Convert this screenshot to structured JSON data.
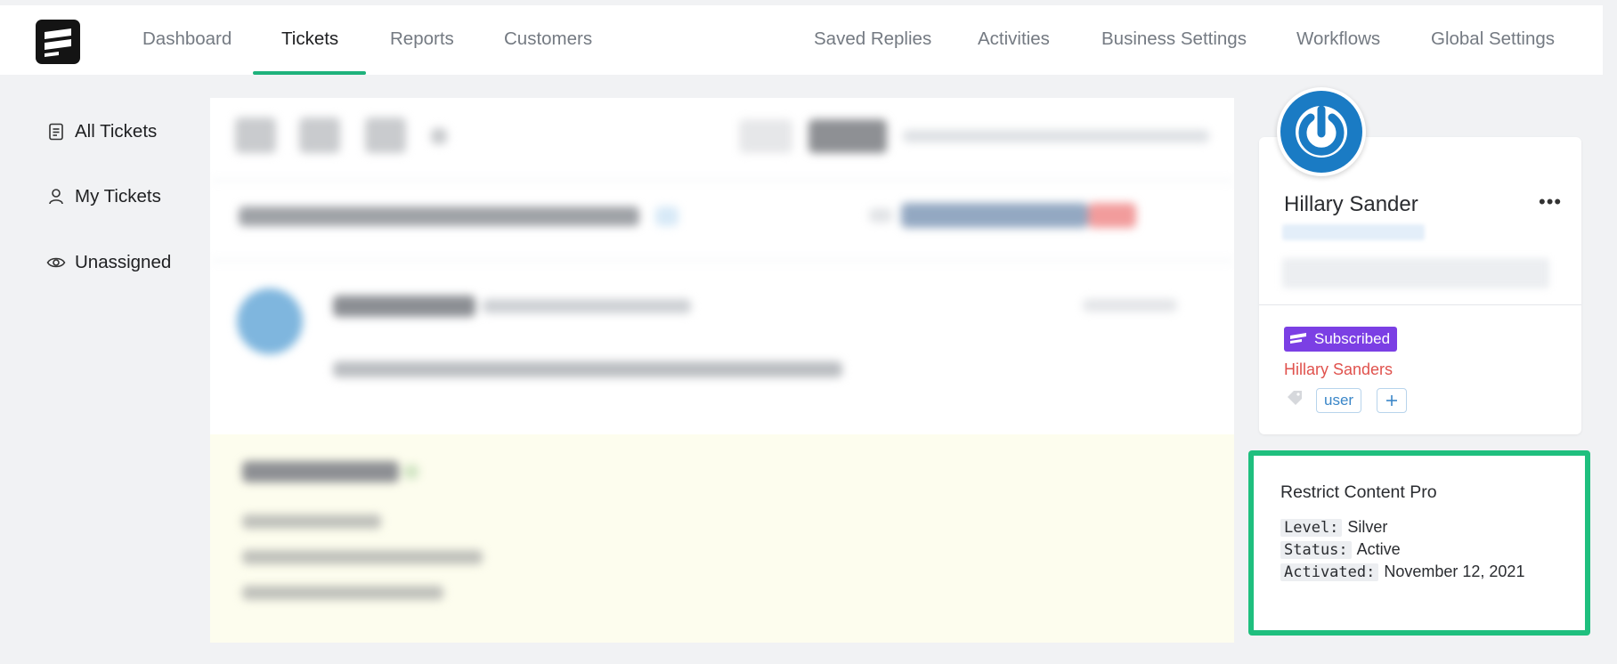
{
  "nav": {
    "left": [
      "Dashboard",
      "Tickets",
      "Reports",
      "Customers"
    ],
    "right": [
      "Saved Replies",
      "Activities",
      "Business Settings",
      "Workflows",
      "Global Settings"
    ],
    "active": "Tickets"
  },
  "sidebar": {
    "items": [
      {
        "label": "All Tickets",
        "icon": "document-icon"
      },
      {
        "label": "My Tickets",
        "icon": "user-icon"
      },
      {
        "label": "Unassigned",
        "icon": "eye-icon"
      }
    ]
  },
  "customer": {
    "name": "Hillary Sander",
    "badge": "Subscribed",
    "contact_link": "Hillary Sanders",
    "tags": [
      "user"
    ]
  },
  "rcp": {
    "title": "Restrict Content Pro",
    "rows": [
      {
        "key": "Level:",
        "value": "Silver"
      },
      {
        "key": "Status:",
        "value": "Active"
      },
      {
        "key": "Activated:",
        "value": "November 12, 2021"
      }
    ]
  },
  "colors": {
    "accent": "#1fb27c",
    "highlight_border": "#1fbf7e",
    "badge": "#7b3fe4",
    "link": "#e0524d",
    "avatar": "#1a7bc4"
  }
}
